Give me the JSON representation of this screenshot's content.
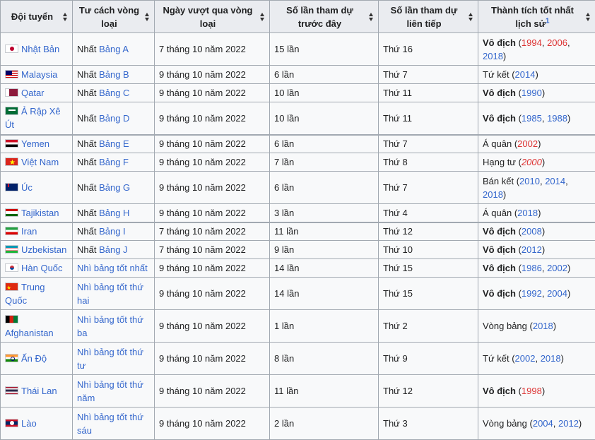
{
  "headers": [
    {
      "label": "Đội tuyển",
      "sup": ""
    },
    {
      "label": "Tư cách vòng loại",
      "sup": ""
    },
    {
      "label": "Ngày vượt qua vòng loại",
      "sup": ""
    },
    {
      "label": "Số lần tham dự trước đây",
      "sup": ""
    },
    {
      "label": "Số lần tham dự liên tiếp",
      "sup": ""
    },
    {
      "label": "Thành tích tốt nhất lịch sử",
      "sup": "1"
    }
  ],
  "rows": [
    {
      "flag": "f-jp",
      "team": "Nhật Bản",
      "qual_pre": "Nhất ",
      "qual_link": "Bảng A",
      "date": "7 tháng 10 năm 2022",
      "prev": "15 lần",
      "consec": "Thứ 16",
      "best": [
        {
          "t": "Vô địch",
          "c": "b"
        },
        {
          "t": " (",
          "c": ""
        },
        {
          "t": "1994",
          "c": "red"
        },
        {
          "t": ", ",
          "c": ""
        },
        {
          "t": "2006",
          "c": "red"
        },
        {
          "t": ", ",
          "c": ""
        },
        {
          "t": "2018",
          "c": "link"
        },
        {
          "t": ")",
          "c": ""
        }
      ],
      "h": 46
    },
    {
      "flag": "f-my",
      "team": "Malaysia",
      "qual_pre": "Nhất ",
      "qual_link": "Bảng B",
      "date": "9 tháng 10 năm 2022",
      "prev": "6 lần",
      "consec": "Thứ 7",
      "best": [
        {
          "t": "Tứ kết (",
          "c": ""
        },
        {
          "t": "2014",
          "c": "link"
        },
        {
          "t": ")",
          "c": ""
        }
      ],
      "h": 26
    },
    {
      "flag": "f-qa",
      "team": "Qatar",
      "qual_pre": "Nhất ",
      "qual_link": "Bảng C",
      "date": "9 tháng 10 năm 2022",
      "prev": "10 lần",
      "consec": "Thứ 11",
      "best": [
        {
          "t": "Vô địch",
          "c": "b"
        },
        {
          "t": " (",
          "c": ""
        },
        {
          "t": "1990",
          "c": "link"
        },
        {
          "t": ")",
          "c": ""
        }
      ],
      "h": 26
    },
    {
      "flag": "f-sa",
      "team": "Ả Rập Xê Út",
      "qual_pre": "Nhất ",
      "qual_link": "Bảng D",
      "date": "9 tháng 10 năm 2022",
      "prev": "10 lần",
      "consec": "Thứ 11",
      "best": [
        {
          "t": "Vô địch",
          "c": "b"
        },
        {
          "t": " (",
          "c": ""
        },
        {
          "t": "1985",
          "c": "link"
        },
        {
          "t": ", ",
          "c": ""
        },
        {
          "t": "1988",
          "c": "link"
        },
        {
          "t": ")",
          "c": ""
        }
      ],
      "h": 46
    },
    {
      "flag": "f-ye",
      "team": "Yemen",
      "qual_pre": "Nhất ",
      "qual_link": "Bảng E",
      "date": "9 tháng 10 năm 2022",
      "prev": "6 lần",
      "consec": "Thứ 7",
      "best": [
        {
          "t": "Á quân (",
          "c": ""
        },
        {
          "t": "2002",
          "c": "red"
        },
        {
          "t": ")",
          "c": ""
        }
      ],
      "h": 26,
      "grp": true
    },
    {
      "flag": "f-vn",
      "team": "Việt Nam",
      "qual_pre": "Nhất ",
      "qual_link": "Bảng F",
      "date": "9 tháng 10 năm 2022",
      "prev": "7 lần",
      "consec": "Thứ 8",
      "best": [
        {
          "t": "Hạng tư (",
          "c": ""
        },
        {
          "t": "2000",
          "c": "red it"
        },
        {
          "t": ")",
          "c": ""
        }
      ],
      "h": 26
    },
    {
      "flag": "f-au",
      "team": "Úc",
      "qual_pre": "Nhất ",
      "qual_link": "Bảng G",
      "date": "9 tháng 10 năm 2022",
      "prev": "6 lần",
      "consec": "Thứ 7",
      "best": [
        {
          "t": "Bán kết (",
          "c": ""
        },
        {
          "t": "2010",
          "c": "link"
        },
        {
          "t": ", ",
          "c": ""
        },
        {
          "t": "2014",
          "c": "link"
        },
        {
          "t": ", ",
          "c": ""
        },
        {
          "t": "2018",
          "c": "link"
        },
        {
          "t": ")",
          "c": ""
        }
      ],
      "h": 46
    },
    {
      "flag": "f-tj",
      "team": "Tajikistan",
      "qual_pre": "Nhất ",
      "qual_link": "Bảng H",
      "date": "9 tháng 10 năm 2022",
      "prev": "3 lần",
      "consec": "Thứ 4",
      "best": [
        {
          "t": "Á quân (",
          "c": ""
        },
        {
          "t": "2018",
          "c": "link"
        },
        {
          "t": ")",
          "c": ""
        }
      ],
      "h": 26
    },
    {
      "flag": "f-ir",
      "team": "Iran",
      "qual_pre": "Nhất ",
      "qual_link": "Bảng I",
      "date": "7 tháng 10 năm 2022",
      "prev": "11 lần",
      "consec": "Thứ 12",
      "best": [
        {
          "t": "Vô địch",
          "c": "b"
        },
        {
          "t": " (",
          "c": ""
        },
        {
          "t": "2008",
          "c": "link"
        },
        {
          "t": ")",
          "c": ""
        }
      ],
      "h": 26,
      "grp": true
    },
    {
      "flag": "f-uz",
      "team": "Uzbekistan",
      "qual_pre": "Nhất ",
      "qual_link": "Bảng J",
      "date": "7 tháng 10 năm 2022",
      "prev": "9 lần",
      "consec": "Thứ 10",
      "best": [
        {
          "t": "Vô địch",
          "c": "b"
        },
        {
          "t": " (",
          "c": ""
        },
        {
          "t": "2012",
          "c": "link"
        },
        {
          "t": ")",
          "c": ""
        }
      ],
      "h": 26
    },
    {
      "flag": "f-kr",
      "team": "Hàn Quốc",
      "qual_pre": "",
      "qual_link": "Nhì bảng tốt nhất",
      "date": "9 tháng 10 năm 2022",
      "prev": "14 lần",
      "consec": "Thứ 15",
      "best": [
        {
          "t": "Vô địch",
          "c": "b"
        },
        {
          "t": " (",
          "c": ""
        },
        {
          "t": "1986",
          "c": "link"
        },
        {
          "t": ", ",
          "c": ""
        },
        {
          "t": "2002",
          "c": "link"
        },
        {
          "t": ")",
          "c": ""
        }
      ],
      "h": 26
    },
    {
      "flag": "f-cn",
      "team": "Trung Quốc",
      "qual_pre": "",
      "qual_link": "Nhì bảng tốt thứ hai",
      "date": "9 tháng 10 năm 2022",
      "prev": "14 lần",
      "consec": "Thứ 15",
      "best": [
        {
          "t": "Vô địch",
          "c": "b"
        },
        {
          "t": " (",
          "c": ""
        },
        {
          "t": "1992",
          "c": "link"
        },
        {
          "t": ", ",
          "c": ""
        },
        {
          "t": "2004",
          "c": "link"
        },
        {
          "t": ")",
          "c": ""
        }
      ],
      "h": 46
    },
    {
      "flag": "f-af",
      "team": "Afghanistan",
      "qual_pre": "",
      "qual_link": "Nhì bảng tốt thứ ba",
      "date": "9 tháng 10 năm 2022",
      "prev": "1 lần",
      "consec": "Thứ 2",
      "best": [
        {
          "t": "Vòng bảng (",
          "c": ""
        },
        {
          "t": "2018",
          "c": "link"
        },
        {
          "t": ")",
          "c": ""
        }
      ],
      "h": 46,
      "wrapflag": true
    },
    {
      "flag": "f-in",
      "team": "Ấn Độ",
      "qual_pre": "",
      "qual_link": "Nhì bảng tốt thứ tư",
      "date": "9 tháng 10 năm 2022",
      "prev": "8 lần",
      "consec": "Thứ 9",
      "best": [
        {
          "t": "Tứ kết (",
          "c": ""
        },
        {
          "t": "2002",
          "c": "link"
        },
        {
          "t": ", ",
          "c": ""
        },
        {
          "t": "2018",
          "c": "link"
        },
        {
          "t": ")",
          "c": ""
        }
      ],
      "h": 46
    },
    {
      "flag": "f-th",
      "team": "Thái Lan",
      "qual_pre": "",
      "qual_link": "Nhì bảng tốt thứ năm",
      "date": "9 tháng 10 năm 2022",
      "prev": "11 lần",
      "consec": "Thứ 12",
      "best": [
        {
          "t": "Vô địch",
          "c": "b"
        },
        {
          "t": " (",
          "c": ""
        },
        {
          "t": "1998",
          "c": "red"
        },
        {
          "t": ")",
          "c": ""
        }
      ],
      "h": 46
    },
    {
      "flag": "f-la",
      "team": "Lào",
      "qual_pre": "",
      "qual_link": "Nhì bảng tốt thứ sáu",
      "date": "9 tháng 10 năm 2022",
      "prev": "2 lần",
      "consec": "Thứ 3",
      "best": [
        {
          "t": "Vòng bảng (",
          "c": ""
        },
        {
          "t": "2004",
          "c": "link"
        },
        {
          "t": ", ",
          "c": ""
        },
        {
          "t": "2012",
          "c": "link"
        },
        {
          "t": ")",
          "c": ""
        }
      ],
      "h": 46
    }
  ]
}
